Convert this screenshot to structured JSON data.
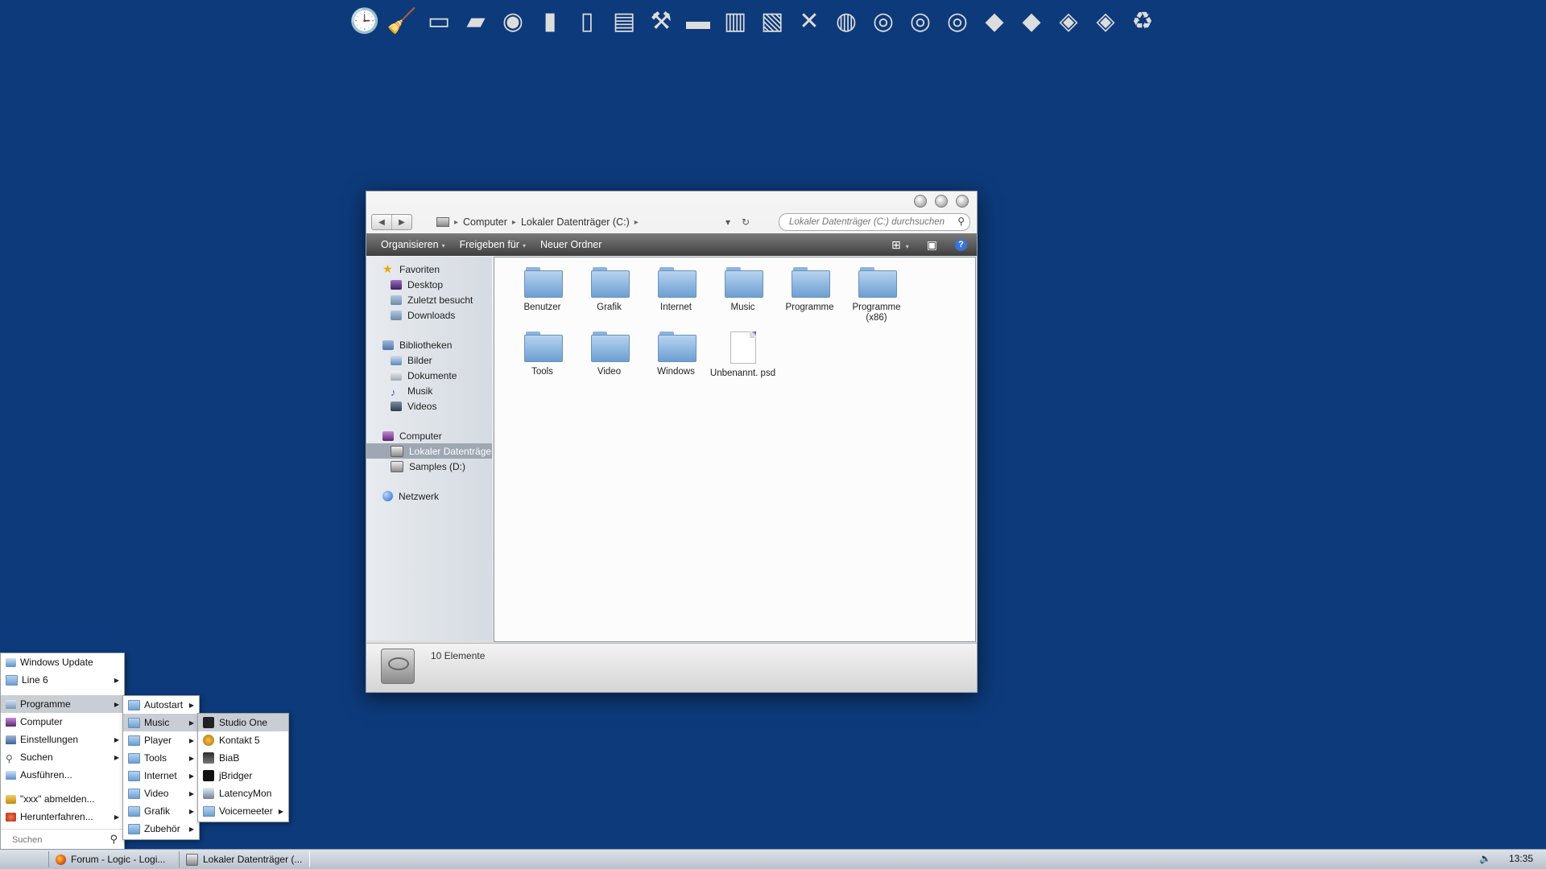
{
  "dock": {
    "icons": [
      {
        "name": "clock-calendar-icon",
        "glyph": "🕒"
      },
      {
        "name": "broom-icon",
        "glyph": "🧹"
      },
      {
        "name": "ram-icon",
        "glyph": "▭"
      },
      {
        "name": "picture-frame-icon",
        "glyph": "▰"
      },
      {
        "name": "speaker-icon",
        "glyph": "◉"
      },
      {
        "name": "tablet-icon",
        "glyph": "▮"
      },
      {
        "name": "phone-icon",
        "glyph": "▯"
      },
      {
        "name": "printer-icon",
        "glyph": "▤"
      },
      {
        "name": "tools-icon",
        "glyph": "⚒"
      },
      {
        "name": "scanner-icon",
        "glyph": "▬"
      },
      {
        "name": "books-icon",
        "glyph": "▥"
      },
      {
        "name": "binder-icon",
        "glyph": "▧"
      },
      {
        "name": "network-cable-icon",
        "glyph": "✕"
      },
      {
        "name": "globe-icon",
        "glyph": "◍"
      },
      {
        "name": "hard-drive-icon-1",
        "glyph": "◎"
      },
      {
        "name": "hard-drive-icon-2",
        "glyph": "◎"
      },
      {
        "name": "hard-drive-icon-3",
        "glyph": "◎"
      },
      {
        "name": "black-drive-icon-1",
        "glyph": "◆"
      },
      {
        "name": "black-drive-icon-2",
        "glyph": "◆"
      },
      {
        "name": "open-drive-icon-1",
        "glyph": "◈"
      },
      {
        "name": "open-drive-icon-2",
        "glyph": "◈"
      },
      {
        "name": "recycle-bin-icon",
        "glyph": "♻"
      }
    ]
  },
  "explorer": {
    "breadcrumb": [
      "Computer",
      "Lokaler Datenträger (C:)"
    ],
    "search_placeholder": "Lokaler Datenträger (C:) durchsuchen",
    "toolbar": {
      "organize": "Organisieren",
      "share": "Freigeben für",
      "new_folder": "Neuer Ordner"
    },
    "nav": {
      "favorites": "Favoriten",
      "desktop": "Desktop",
      "recent": "Zuletzt besucht",
      "downloads": "Downloads",
      "libraries": "Bibliotheken",
      "pictures": "Bilder",
      "documents": "Dokumente",
      "music": "Musik",
      "videos": "Videos",
      "computer": "Computer",
      "local_disk": "Lokaler Datenträger",
      "samples": "Samples (D:)",
      "network": "Netzwerk"
    },
    "files": [
      {
        "label": "Benutzer",
        "kind": "folder"
      },
      {
        "label": "Grafik",
        "kind": "folder"
      },
      {
        "label": "Internet",
        "kind": "folder"
      },
      {
        "label": "Music",
        "kind": "folder"
      },
      {
        "label": "Programme",
        "kind": "folder"
      },
      {
        "label": "Programme (x86)",
        "kind": "folder"
      },
      {
        "label": "Tools",
        "kind": "folder"
      },
      {
        "label": "Video",
        "kind": "folder"
      },
      {
        "label": "Windows",
        "kind": "folder"
      },
      {
        "label": "Unbenannt. psd",
        "kind": "file"
      }
    ],
    "status": "10 Elemente"
  },
  "start_menu": {
    "items": {
      "windows_update": "Windows Update",
      "line6": "Line 6",
      "programs": "Programme",
      "computer": "Computer",
      "settings": "Einstellungen",
      "search": "Suchen",
      "run": "Ausführen...",
      "logoff": "\"xxx\" abmelden...",
      "shutdown": "Herunterfahren..."
    },
    "search_placeholder": "Suchen"
  },
  "programs_menu": {
    "autostart": "Autostart",
    "music": "Music",
    "player": "Player",
    "tools": "Tools",
    "internet": "Internet",
    "video": "Video",
    "grafik": "Grafik",
    "zubehoer": "Zubehör"
  },
  "music_menu": {
    "studio_one": "Studio One",
    "kontakt": "Kontakt 5",
    "biab": "BiaB",
    "jbridger": "jBridger",
    "latencymon": "LatencyMon",
    "voicemeeter": "Voicemeeter"
  },
  "taskbar": {
    "tasks": [
      {
        "label": "Forum - Logic - Logi..."
      },
      {
        "label": "Lokaler Datenträger (..."
      }
    ],
    "clock": "13:35"
  }
}
